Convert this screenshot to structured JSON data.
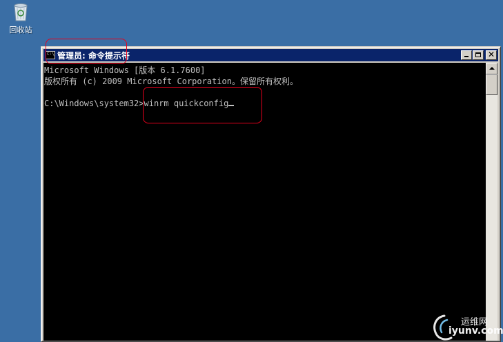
{
  "desktop": {
    "recycle_bin_label": "回收站",
    "recycle_bin_icon": "recycle-bin-icon"
  },
  "window": {
    "title": "管理员: 命令提示符",
    "title_icon_glyph": "C:\\",
    "close_glyph": "✕",
    "console": {
      "lines": [
        "Microsoft Windows [版本 6.1.7600]",
        "版权所有 (c) 2009 Microsoft Corporation。保留所有权利。",
        "",
        "C:\\Windows\\system32>winrm quickconfig"
      ]
    }
  },
  "watermark": {
    "text_cn": "运维网",
    "text_url": "iyunv.com"
  },
  "colors": {
    "desktop_bg": "#3a6ea5",
    "titlebar_bg": "#0a246a",
    "console_bg": "#000000",
    "console_fg": "#c0c0c0",
    "annotation": "#e8001c"
  }
}
